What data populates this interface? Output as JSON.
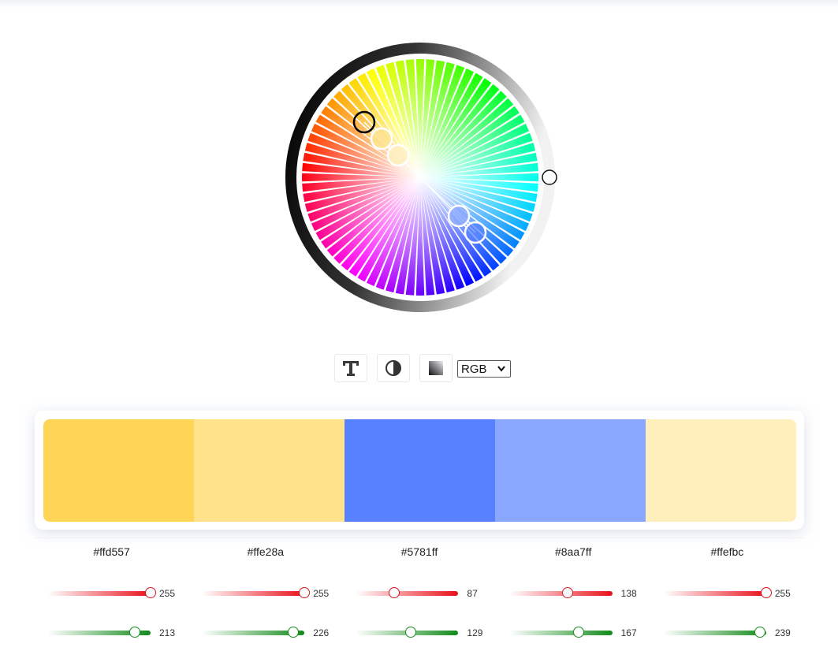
{
  "toolbar": {
    "buttons": [
      {
        "name": "text-button",
        "icon": "text-icon"
      },
      {
        "name": "contrast-button",
        "icon": "contrast-icon"
      },
      {
        "name": "gradient-button",
        "icon": "gradient-icon"
      }
    ],
    "mode_select": {
      "selected": "RGB"
    }
  },
  "palette": [
    {
      "hex": "#ffd557",
      "r": 255,
      "g": 213
    },
    {
      "hex": "#ffe28a",
      "r": 255,
      "g": 226
    },
    {
      "hex": "#5781ff",
      "r": 87,
      "g": 129
    },
    {
      "hex": "#8aa7ff",
      "r": 138,
      "g": 167
    },
    {
      "hex": "#ffefbc",
      "r": 255,
      "g": 239
    }
  ],
  "slider_max": 255,
  "colors": {
    "red_channel": "#e8101a",
    "green_channel": "#128a1a"
  }
}
